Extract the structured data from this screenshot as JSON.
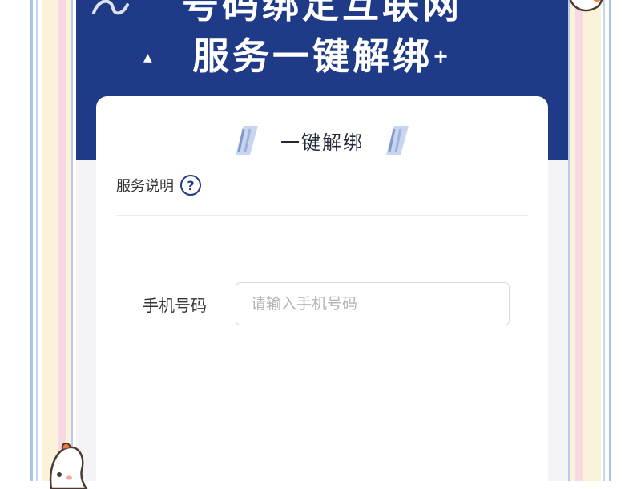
{
  "banner": {
    "line1": "号码绑定互联网",
    "line2": "服务一键解绑",
    "plus": "+"
  },
  "card": {
    "title": "一键解绑",
    "service_label": "服务说明",
    "help_symbol": "?",
    "phone_label": "手机号码",
    "phone_placeholder": "请输入手机号码",
    "phone_value": ""
  },
  "colors": {
    "banner_bg": "#1f3a86",
    "card_bg": "#ffffff",
    "accent": "#1f3a86"
  },
  "icons": [
    "swirl-decoration",
    "sparkle-icon",
    "slash-decoration-icon",
    "help-icon",
    "mascot-icon"
  ]
}
